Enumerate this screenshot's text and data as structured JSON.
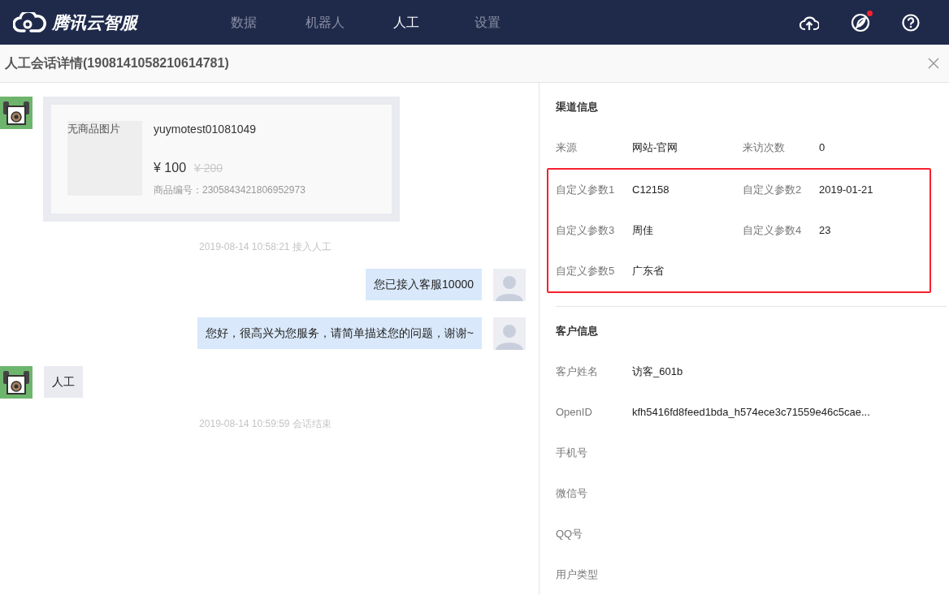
{
  "header": {
    "brand": "腾讯云智服",
    "nav": [
      {
        "label": "数据",
        "selected": false
      },
      {
        "label": "机器人",
        "selected": false
      },
      {
        "label": "人工",
        "selected": true
      },
      {
        "label": "设置",
        "selected": false
      }
    ],
    "notification_dot": true
  },
  "page_title": "人工会话详情(1908141058210614781)",
  "chat": [
    {
      "kind": "product",
      "image_alt": "无商品图片",
      "name": "yuymotest01081049",
      "price": "¥ 100",
      "original_price": "¥ 200",
      "code": "商品编号：2305843421806952973"
    },
    {
      "kind": "notice",
      "text": "2019-08-14 10:58:21 接入人工"
    },
    {
      "kind": "outgoing",
      "text": "您已接入客服10000"
    },
    {
      "kind": "outgoing",
      "text": "您好，很高兴为您服务，请简单描述您的问题，谢谢~"
    },
    {
      "kind": "incoming",
      "text": "人工"
    },
    {
      "kind": "notice",
      "text": "2019-08-14 10:59:59 会话结束"
    }
  ],
  "channel_info": {
    "title": "渠道信息",
    "rows": [
      {
        "highlighted": false,
        "fields": [
          {
            "label": "来源",
            "value": "网站-官网"
          },
          {
            "label": "来访次数",
            "value": "0"
          }
        ]
      },
      {
        "highlighted": true,
        "fields": [
          {
            "label": "自定义参数1",
            "value": "C12158"
          },
          {
            "label": "自定义参数2",
            "value": "2019-01-21"
          }
        ]
      },
      {
        "highlighted": true,
        "fields": [
          {
            "label": "自定义参数3",
            "value": "周佳"
          },
          {
            "label": "自定义参数4",
            "value": "23"
          }
        ]
      },
      {
        "highlighted": true,
        "fields": [
          {
            "label": "自定义参数5",
            "value": "广东省"
          }
        ]
      }
    ]
  },
  "customer_info": {
    "title": "客户信息",
    "rows": [
      {
        "label": "客户姓名",
        "value": "访客_601b"
      },
      {
        "label": "OpenID",
        "value": "kfh5416fd8feed1bda_h574ece3c71559e46c5cae..."
      },
      {
        "label": "手机号"
      },
      {
        "label": "微信号"
      },
      {
        "label": "QQ号"
      },
      {
        "label": "用户类型"
      }
    ]
  }
}
